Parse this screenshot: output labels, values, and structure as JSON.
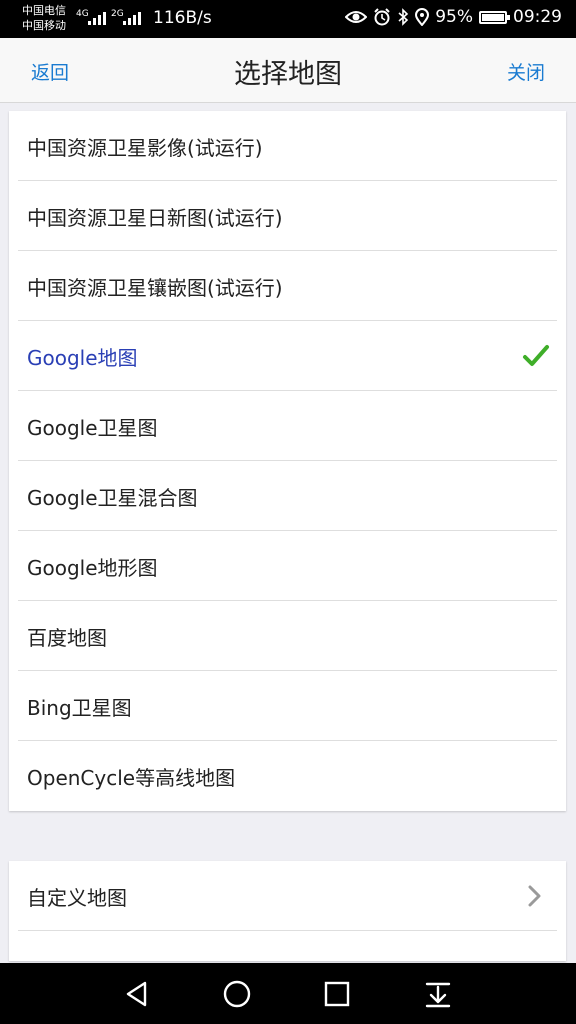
{
  "status_bar": {
    "carrier_1": "中国电信",
    "carrier_2": "中国移动",
    "network_1": "4G",
    "network_2": "2G",
    "speed": "116B/s",
    "battery": "95%",
    "time": "09:29",
    "icons": [
      "eye-icon",
      "alarm-icon",
      "bluetooth-icon",
      "location-icon",
      "battery-icon"
    ]
  },
  "nav": {
    "back": "返回",
    "title": "选择地图",
    "close": "关闭"
  },
  "map_list": {
    "items": [
      {
        "label": "中国资源卫星影像(试运行)"
      },
      {
        "label": "中国资源卫星日新图(试运行)"
      },
      {
        "label": "中国资源卫星镶嵌图(试运行)"
      },
      {
        "label": "Google地图",
        "selected": true
      },
      {
        "label": "Google卫星图"
      },
      {
        "label": "Google卫星混合图"
      },
      {
        "label": "Google地形图"
      },
      {
        "label": "百度地图"
      },
      {
        "label": "Bing卫星图"
      },
      {
        "label": "OpenCycle等高线地图"
      }
    ]
  },
  "custom": {
    "label": "自定义地图"
  },
  "colors": {
    "accent": "#1a7bd1",
    "selected_text": "#2a3fb5",
    "check": "#3fae29",
    "background": "#efeff4"
  },
  "system_nav": [
    "back-triangle-icon",
    "home-circle-icon",
    "recents-square-icon",
    "notification-pull-icon"
  ]
}
